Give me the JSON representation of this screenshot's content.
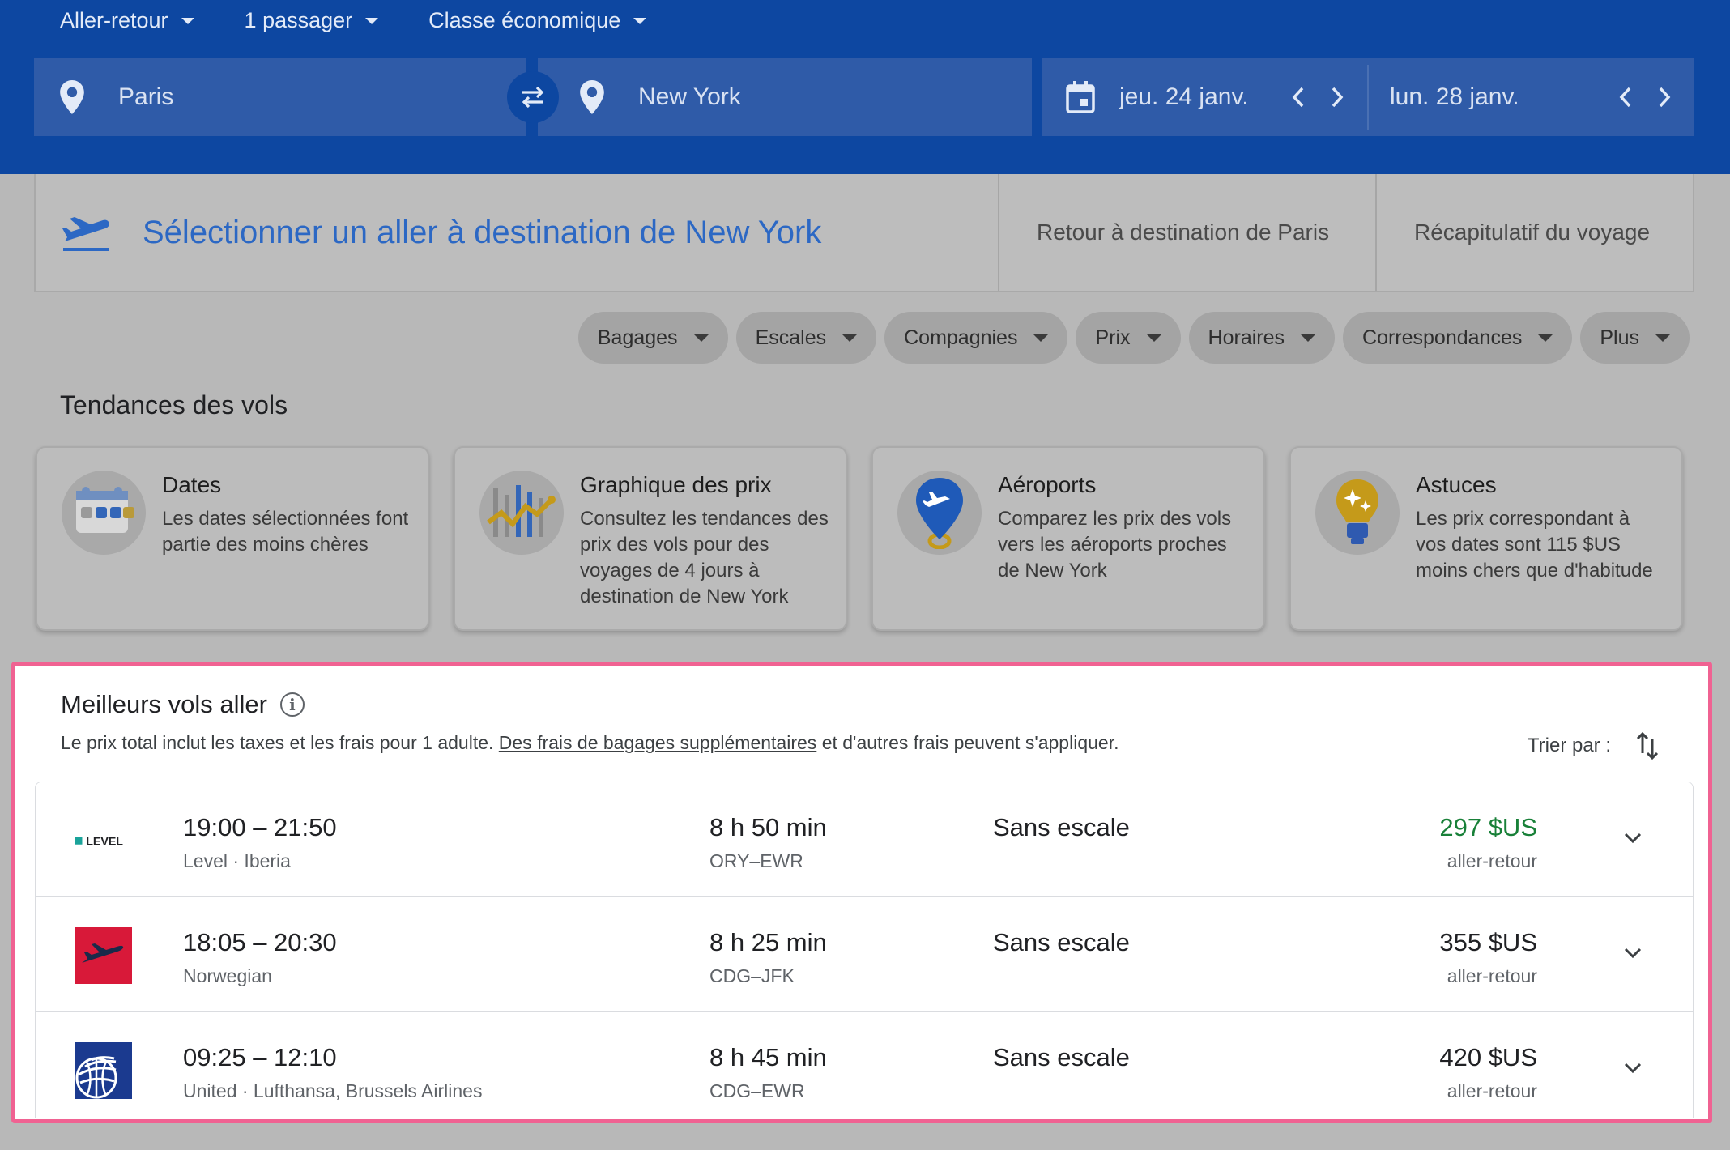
{
  "search": {
    "trip_type": "Aller-retour",
    "passengers": "1 passager",
    "cabin": "Classe économique",
    "from": "Paris",
    "to": "New York",
    "depart_date": "jeu. 24 janv.",
    "return_date": "lun. 28 janv."
  },
  "steps": {
    "current": "Sélectionner un aller à destination de New York",
    "next": "Retour à destination de Paris",
    "summary": "Récapitulatif du voyage"
  },
  "filters": [
    "Bagages",
    "Escales",
    "Compagnies",
    "Prix",
    "Horaires",
    "Correspondances",
    "Plus"
  ],
  "trends": {
    "title": "Tendances des vols",
    "cards": [
      {
        "title": "Dates",
        "text": "Les dates sélectionnées font partie des moins chères",
        "icon": "calendar-icon"
      },
      {
        "title": "Graphique des prix",
        "text": "Consultez les tendances des prix des vols pour des voyages de 4 jours à destination de New York",
        "icon": "price-graph-icon"
      },
      {
        "title": "Aéroports",
        "text": "Comparez les prix des vols vers les aéroports proches de New York",
        "icon": "airport-pin-icon"
      },
      {
        "title": "Astuces",
        "text": "Les prix correspondant à vos dates sont 115 $US moins chers que d'habitude",
        "icon": "lightbulb-icon"
      }
    ]
  },
  "best": {
    "title": "Meilleurs vols aller",
    "sub_before": "Le prix total inclut les taxes et les frais pour 1 adulte.",
    "sub_link": "Des frais de bagages supplémentaires",
    "sub_after": "et d'autres frais peuvent s'appliquer.",
    "sort_label": "Trier par :"
  },
  "flights": [
    {
      "times": "19:00 – 21:50",
      "airline": "Level · Iberia",
      "duration": "8 h 50 min",
      "route": "ORY–EWR",
      "stops": "Sans escale",
      "price": "297 $US",
      "price_type": "aller-retour",
      "logo_text": "LEVEL"
    },
    {
      "times": "18:05 – 20:30",
      "airline": "Norwegian",
      "duration": "8 h 25 min",
      "route": "CDG–JFK",
      "stops": "Sans escale",
      "price": "355 $US",
      "price_type": "aller-retour"
    },
    {
      "times": "09:25 – 12:10",
      "airline": "United · Lufthansa, Brussels Airlines",
      "duration": "8 h 45 min",
      "route": "CDG–EWR",
      "stops": "Sans escale",
      "price": "420 $US",
      "price_type": "aller-retour"
    }
  ],
  "colors": {
    "header_blue": "#0d47a1",
    "link_blue": "#2c68c4",
    "best_price_green": "#188038",
    "highlight_pink": "#f06292"
  }
}
